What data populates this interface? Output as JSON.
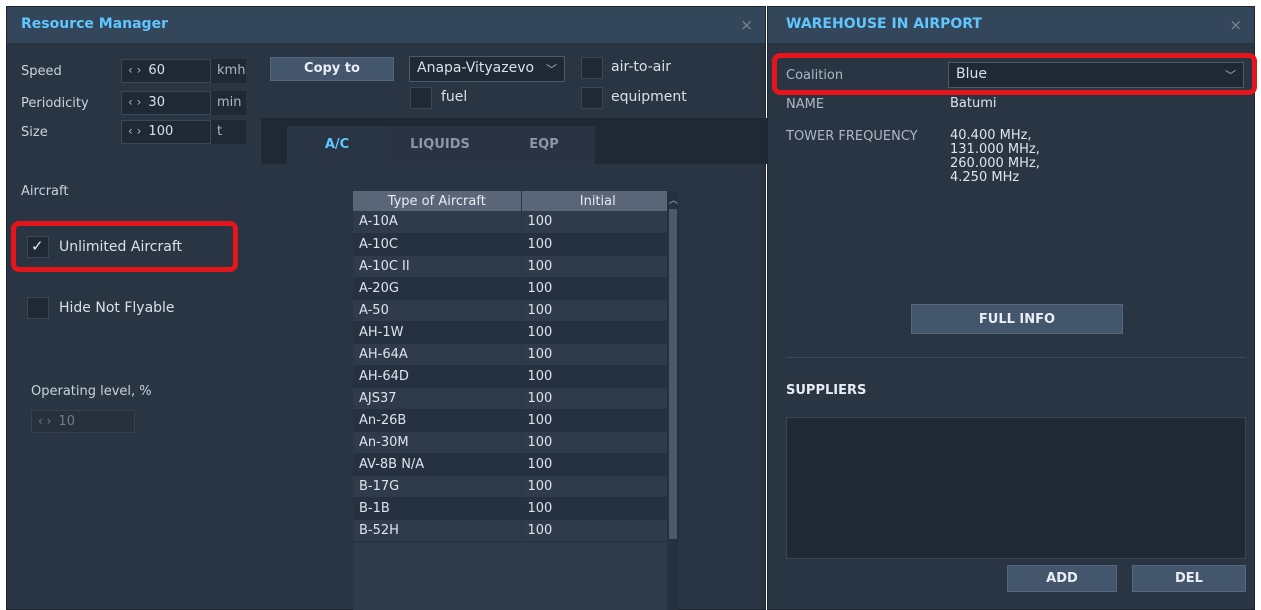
{
  "resource_manager": {
    "title": "Resource Manager",
    "close": "×",
    "speed": {
      "label": "Speed",
      "value": "60",
      "unit": "kmh"
    },
    "periodicity": {
      "label": "Periodicity",
      "value": "30",
      "unit": "min"
    },
    "size": {
      "label": "Size",
      "value": "100",
      "unit": "t"
    },
    "spinner_arrows": "‹ ›",
    "copy_to_label": "Copy to",
    "airport_select": "Anapa-Vityazevo",
    "checkboxes": {
      "air_to_air": "air-to-air",
      "fuel": "fuel",
      "equipment": "equipment"
    },
    "tabs": [
      "A/C",
      "LIQUIDS",
      "EQP"
    ],
    "aircraft_heading": "Aircraft",
    "unlimited_aircraft": {
      "label": "Unlimited Aircraft",
      "checked": true
    },
    "hide_not_flyable": {
      "label": "Hide Not Flyable",
      "checked": false
    },
    "operating_level": {
      "label": "Operating level, %",
      "value": "10"
    },
    "table": {
      "headers": [
        "Type of Aircraft",
        "Initial"
      ],
      "rows": [
        [
          "A-10A",
          "100"
        ],
        [
          "A-10C",
          "100"
        ],
        [
          "A-10C II",
          "100"
        ],
        [
          "A-20G",
          "100"
        ],
        [
          "A-50",
          "100"
        ],
        [
          "AH-1W",
          "100"
        ],
        [
          "AH-64A",
          "100"
        ],
        [
          "AH-64D",
          "100"
        ],
        [
          "AJS37",
          "100"
        ],
        [
          "An-26B",
          "100"
        ],
        [
          "An-30M",
          "100"
        ],
        [
          "AV-8B N/A",
          "100"
        ],
        [
          "B-17G",
          "100"
        ],
        [
          "B-1B",
          "100"
        ],
        [
          "B-52H",
          "100"
        ]
      ]
    }
  },
  "warehouse": {
    "title": "WAREHOUSE IN AIRPORT",
    "close": "×",
    "coalition_label": "Coalition",
    "coalition_value": "Blue",
    "name_label": "NAME",
    "name_value": "Batumi",
    "tower_label": "TOWER FREQUENCY",
    "tower_values": [
      "40.400 MHz,",
      "131.000 MHz,",
      "260.000 MHz,",
      "4.250 MHz"
    ],
    "full_info_label": "FULL INFO",
    "suppliers_label": "SUPPLIERS",
    "add_label": "ADD",
    "del_label": "DEL"
  },
  "colors": {
    "accent": "#5fc6ff",
    "highlight": "#e5151b",
    "panel_bg": "#2a3544"
  }
}
